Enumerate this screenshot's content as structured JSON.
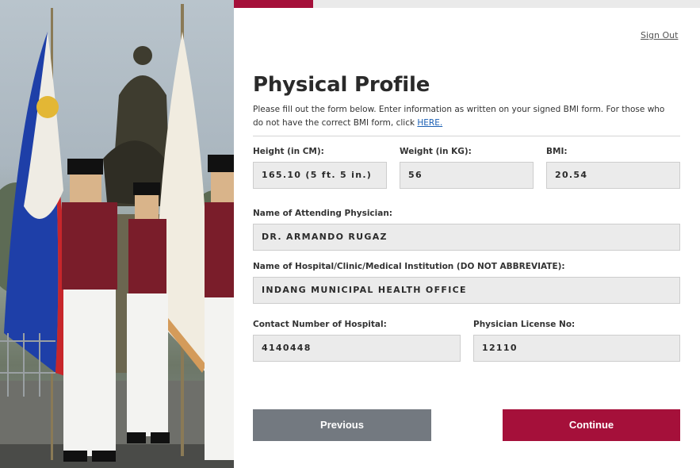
{
  "progress": {
    "percent": 17,
    "color": "#a5103a"
  },
  "header": {
    "signout_label": "Sign Out"
  },
  "page": {
    "title": "Physical Profile",
    "intro_text": "Please fill out the form below. Enter information as written on your signed BMI form. For those who do not have the correct BMI form, click ",
    "intro_link": "HERE."
  },
  "form": {
    "height": {
      "label": "Height (in CM):",
      "value": "165.10 (5 ft. 5 in.)"
    },
    "weight": {
      "label": "Weight (in KG):",
      "value": "56"
    },
    "bmi": {
      "label": "BMI:",
      "value": "20.54"
    },
    "physician": {
      "label": "Name of Attending Physician:",
      "value": "DR. ARMANDO RUGAZ"
    },
    "hospital": {
      "label": "Name of Hospital/Clinic/Medical Institution (DO NOT ABBREVIATE):",
      "value": "INDANG MUNICIPAL HEALTH OFFICE"
    },
    "contact": {
      "label": "Contact Number of Hospital:",
      "value": "4140448"
    },
    "license": {
      "label": "Physician License No:",
      "value": "12110"
    }
  },
  "buttons": {
    "previous": "Previous",
    "continue": "Continue"
  },
  "colors": {
    "accent": "#a5103a",
    "secondary_button": "#737980",
    "field_bg": "#ebebeb"
  }
}
